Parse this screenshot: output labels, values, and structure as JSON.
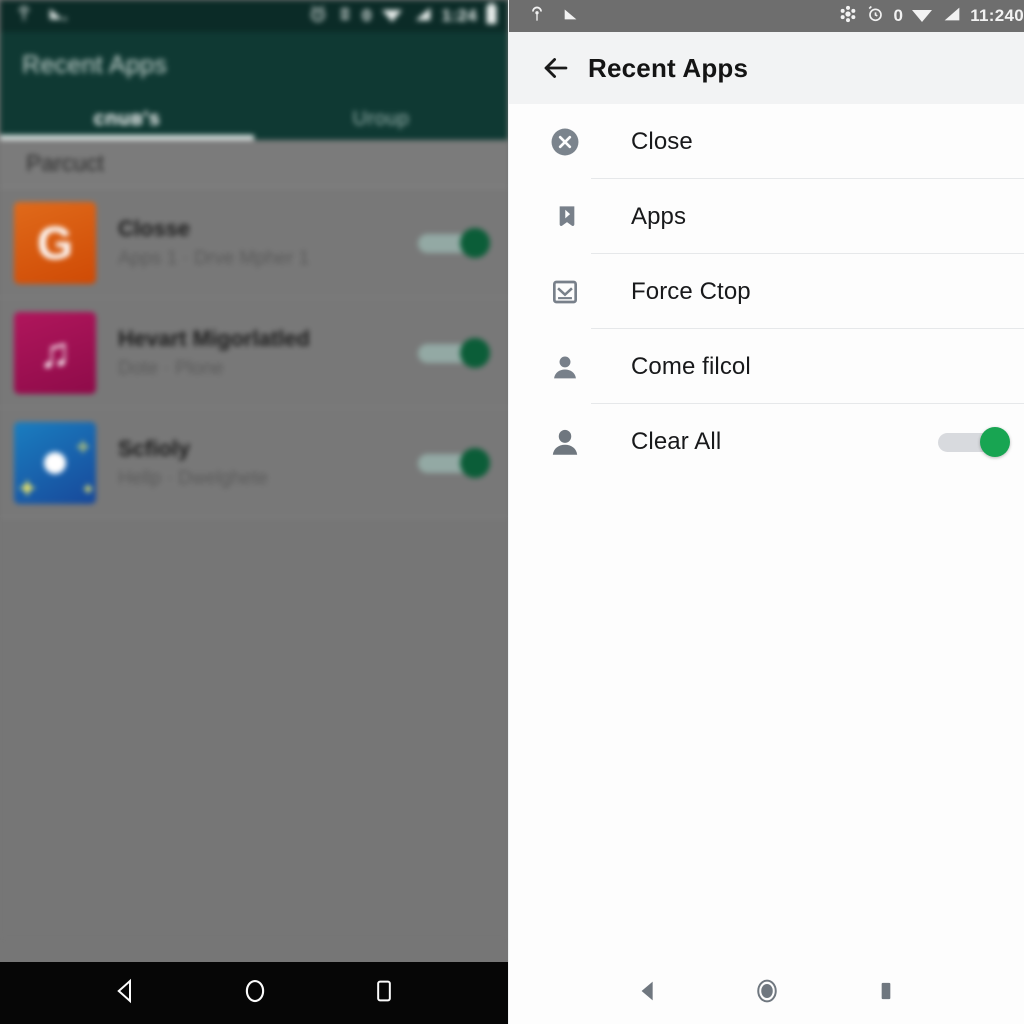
{
  "left_panel": {
    "status_bar": {
      "left_icons": [
        "vpn-key-icon",
        "signal-weak-icon"
      ],
      "right_icons": [
        "alarm-icon",
        "bluetooth-icon",
        "wifi-icon",
        "signal-icon",
        "battery-icon"
      ],
      "notification_count": "0",
      "clock": "1:24",
      "bg_color": "#0b2b27"
    },
    "app_bar": {
      "title": "Recent Apps",
      "bg_color": "#0f3933"
    },
    "tabs": [
      {
        "label": "cnuв's",
        "active": true
      },
      {
        "label": "Uroup",
        "active": false
      }
    ],
    "section_header": "Parcuct",
    "rows": [
      {
        "name": "Closse",
        "subtitle": "Apps 1 · Drve Mpher 1",
        "icon": "google-app-icon",
        "icon_glyph": "G",
        "toggle": "on"
      },
      {
        "name": "Hevart Migorlatled",
        "subtitle": "Dote · Plone",
        "icon": "music-app-icon",
        "icon_glyph": "♫",
        "toggle": "on"
      },
      {
        "name": "Scfioly",
        "subtitle": "Hellp · Dwelghete",
        "icon": "maps-app-icon",
        "icon_glyph": "",
        "toggle": "on"
      }
    ],
    "nav_bar": {
      "items": [
        "back-nav-icon",
        "home-nav-icon",
        "recents-nav-icon"
      ],
      "bg_color": "#060606"
    },
    "accent_color": "#0b5d38"
  },
  "right_panel": {
    "status_bar": {
      "left_icons": [
        "vpn-key-icon",
        "signal-weak-icon"
      ],
      "right_icons": [
        "sync-icon",
        "alarm-icon",
        "wifi-icon",
        "signal-icon"
      ],
      "notification_count": "0",
      "clock": "11:240",
      "bg_color": "#6e6e6e"
    },
    "app_bar": {
      "back": "back-arrow-icon",
      "title": "Recent Apps",
      "bg_color": "#f2f3f4"
    },
    "rows": [
      {
        "label": "Close",
        "icon": "close-circle-icon",
        "toggle": null
      },
      {
        "label": "Apps",
        "icon": "bookmark-icon",
        "toggle": null
      },
      {
        "label": "Force Ctop",
        "icon": "envelope-icon",
        "toggle": null
      },
      {
        "label": "Come filcol",
        "icon": "person-icon",
        "toggle": null
      },
      {
        "label": "Clear All",
        "icon": "person-icon",
        "toggle": "on"
      }
    ],
    "nav_bar": {
      "items": [
        "back-nav-icon",
        "home-nav-icon",
        "recents-nav-icon"
      ],
      "bg_color": "#fdfdfd"
    },
    "accent_color": "#18a552"
  }
}
